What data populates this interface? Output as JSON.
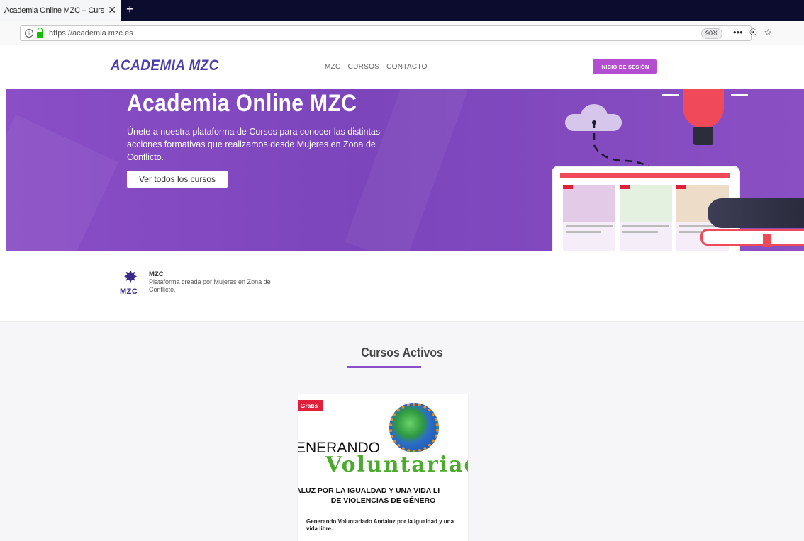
{
  "browser": {
    "tab_title": "Academia Online MZC – Cursos So",
    "tab_close": "✕",
    "new_tab": "+",
    "url": "https://academia.mzc.es",
    "zoom": "90%",
    "more_actions": "•••",
    "pocket": "☉",
    "bookmark": "☆"
  },
  "header": {
    "logo": "ACADEMIA MZC",
    "menu": [
      "MZC",
      "CURSOS",
      "CONTACTO"
    ],
    "login_label": "INICIO DE SESIÓN"
  },
  "hero": {
    "title": "Academia Online MZC",
    "text": "Únete a nuestra plataforma de Cursos para conocer las distintas acciones formativas que realizamos desde Mujeres en Zona de Conflicto.",
    "button_label": "Ver todos los cursos"
  },
  "about": {
    "logo_text": "MZC",
    "name": "MZC",
    "description": "Plataforma creada por Mujeres en Zona de Conflicto."
  },
  "courses": {
    "title": "Cursos Activos",
    "items": [
      {
        "badge": "Gratis",
        "image_line1": "ENERANDO",
        "image_line2": "Voluntariado",
        "image_line3": "ALUZ POR LA IGUALDAD Y UNA VIDA LI",
        "image_line4": "DE VIOLENCIAS DE GÉNERO",
        "name": "Generando Voluntariado Andaluz por la Igualdad y una vida libre..."
      }
    ]
  },
  "colors": {
    "brand_purple": "#8a4ec6",
    "logo_blue": "#4a3ea8",
    "login_pink": "#b44ed0",
    "badge_red": "#e0203a"
  }
}
